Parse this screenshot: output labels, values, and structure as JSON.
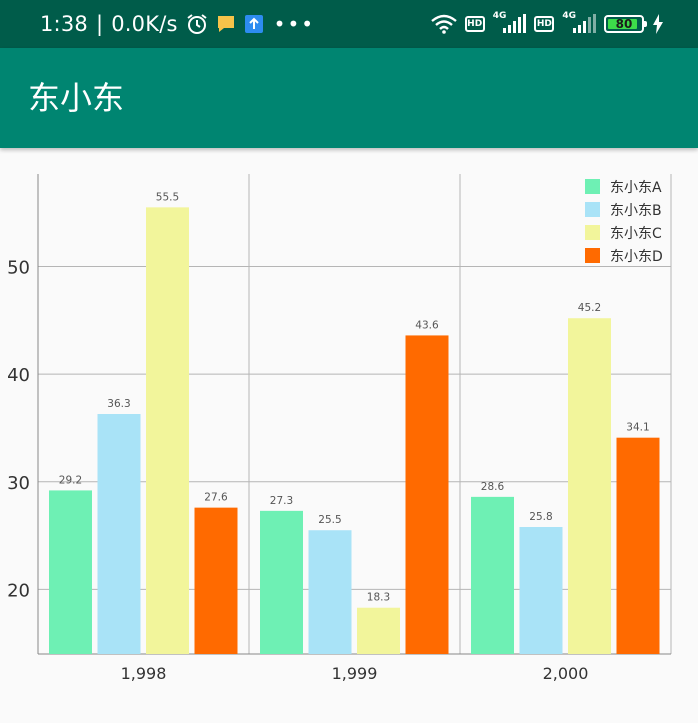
{
  "status_bar": {
    "time": "1:38",
    "separator": "|",
    "speed": "0.0K/s",
    "battery_level": "80",
    "icons": [
      "alarm-icon",
      "message-icon",
      "upload-notification-icon",
      "more-dots-icon",
      "wifi-icon",
      "hd-icon",
      "signal-4g-icon",
      "hd-icon",
      "signal-4g-icon",
      "battery-icon",
      "charging-bolt-icon"
    ],
    "hd_label": "HD",
    "net_label": "4G",
    "bg_color": "#005c4a"
  },
  "app_bar": {
    "title": "东小东",
    "bg_color": "#008571"
  },
  "chart_data": {
    "type": "bar",
    "categories": [
      "1,998",
      "1,999",
      "2,000"
    ],
    "series": [
      {
        "name": "东小东A",
        "color": "#6ef0b4",
        "values": [
          29.2,
          27.3,
          28.6
        ]
      },
      {
        "name": "东小东B",
        "color": "#a9e3f7",
        "values": [
          36.3,
          25.5,
          25.8
        ]
      },
      {
        "name": "东小东C",
        "color": "#f2f59b",
        "values": [
          55.5,
          18.3,
          45.2
        ]
      },
      {
        "name": "东小东D",
        "color": "#ff6a00",
        "values": [
          27.6,
          43.6,
          34.1
        ]
      }
    ],
    "value_labels": [
      [
        "29.2",
        "27.3",
        "28.6"
      ],
      [
        "36.3",
        "25.5",
        "25.8"
      ],
      [
        "55.5",
        "18.3",
        "45.2"
      ],
      [
        "27.6",
        "43.6",
        "34.1"
      ]
    ],
    "y_ticks": [
      20,
      30,
      40,
      50
    ],
    "ylim": [
      14,
      58.6
    ],
    "grid": true,
    "legend_position": "top-right"
  }
}
